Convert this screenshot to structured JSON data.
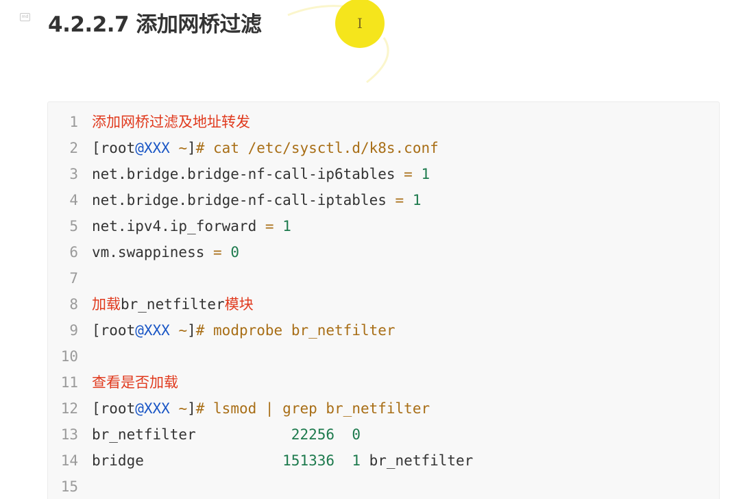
{
  "page": {
    "heading_icon": "md",
    "heading": "4.2.2.7 添加网桥过滤",
    "cursor_glyph": "I"
  },
  "code_block": {
    "lines": [
      {
        "n": "1",
        "segments": [
          {
            "t": "添加网桥过滤及地址转发",
            "c": "comment"
          }
        ]
      },
      {
        "n": "2",
        "segments": [
          {
            "t": "[root",
            "c": "plain"
          },
          {
            "t": "@XXX",
            "c": "kw"
          },
          {
            "t": " ~",
            "c": "op"
          },
          {
            "t": "]",
            "c": "plain"
          },
          {
            "t": "# cat /etc/sysctl.d/k8s.conf",
            "c": "op"
          }
        ]
      },
      {
        "n": "3",
        "segments": [
          {
            "t": "net.bridge.bridge-nf-call-ip6tables ",
            "c": "plain"
          },
          {
            "t": "=",
            "c": "op"
          },
          {
            "t": " ",
            "c": "plain"
          },
          {
            "t": "1",
            "c": "num"
          }
        ]
      },
      {
        "n": "4",
        "segments": [
          {
            "t": "net.bridge.bridge-nf-call-iptables ",
            "c": "plain"
          },
          {
            "t": "=",
            "c": "op"
          },
          {
            "t": " ",
            "c": "plain"
          },
          {
            "t": "1",
            "c": "num"
          }
        ]
      },
      {
        "n": "5",
        "segments": [
          {
            "t": "net.ipv4.ip_forward ",
            "c": "plain"
          },
          {
            "t": "=",
            "c": "op"
          },
          {
            "t": " ",
            "c": "plain"
          },
          {
            "t": "1",
            "c": "num"
          }
        ]
      },
      {
        "n": "6",
        "segments": [
          {
            "t": "vm.swappiness ",
            "c": "plain"
          },
          {
            "t": "=",
            "c": "op"
          },
          {
            "t": " ",
            "c": "plain"
          },
          {
            "t": "0",
            "c": "num"
          }
        ]
      },
      {
        "n": "7",
        "segments": []
      },
      {
        "n": "8",
        "segments": [
          {
            "t": "加载",
            "c": "comment"
          },
          {
            "t": "br_netfilter",
            "c": "plain"
          },
          {
            "t": "模块",
            "c": "comment"
          }
        ]
      },
      {
        "n": "9",
        "segments": [
          {
            "t": "[root",
            "c": "plain"
          },
          {
            "t": "@XXX",
            "c": "kw"
          },
          {
            "t": " ~",
            "c": "op"
          },
          {
            "t": "]",
            "c": "plain"
          },
          {
            "t": "# modprobe br_netfilter",
            "c": "op"
          }
        ]
      },
      {
        "n": "10",
        "segments": []
      },
      {
        "n": "11",
        "segments": [
          {
            "t": "查看是否加载",
            "c": "comment"
          }
        ]
      },
      {
        "n": "12",
        "segments": [
          {
            "t": "[root",
            "c": "plain"
          },
          {
            "t": "@XXX",
            "c": "kw"
          },
          {
            "t": " ~",
            "c": "op"
          },
          {
            "t": "]",
            "c": "plain"
          },
          {
            "t": "# lsmod | grep br_netfilter",
            "c": "op"
          }
        ]
      },
      {
        "n": "13",
        "segments": [
          {
            "t": "br_netfilter           ",
            "c": "plain"
          },
          {
            "t": "22256",
            "c": "num"
          },
          {
            "t": "  ",
            "c": "plain"
          },
          {
            "t": "0",
            "c": "num"
          }
        ]
      },
      {
        "n": "14",
        "segments": [
          {
            "t": "bridge                ",
            "c": "plain"
          },
          {
            "t": "151336",
            "c": "num"
          },
          {
            "t": "  ",
            "c": "plain"
          },
          {
            "t": "1",
            "c": "num"
          },
          {
            "t": " br_netfilter",
            "c": "plain"
          }
        ]
      },
      {
        "n": "15",
        "segments": []
      }
    ]
  },
  "colors": {
    "comment": "#e03a1e",
    "keyword": "#1a56c5",
    "operator": "#a86e16",
    "number": "#1d7a4d",
    "cursor_highlight": "#f5e51c"
  }
}
